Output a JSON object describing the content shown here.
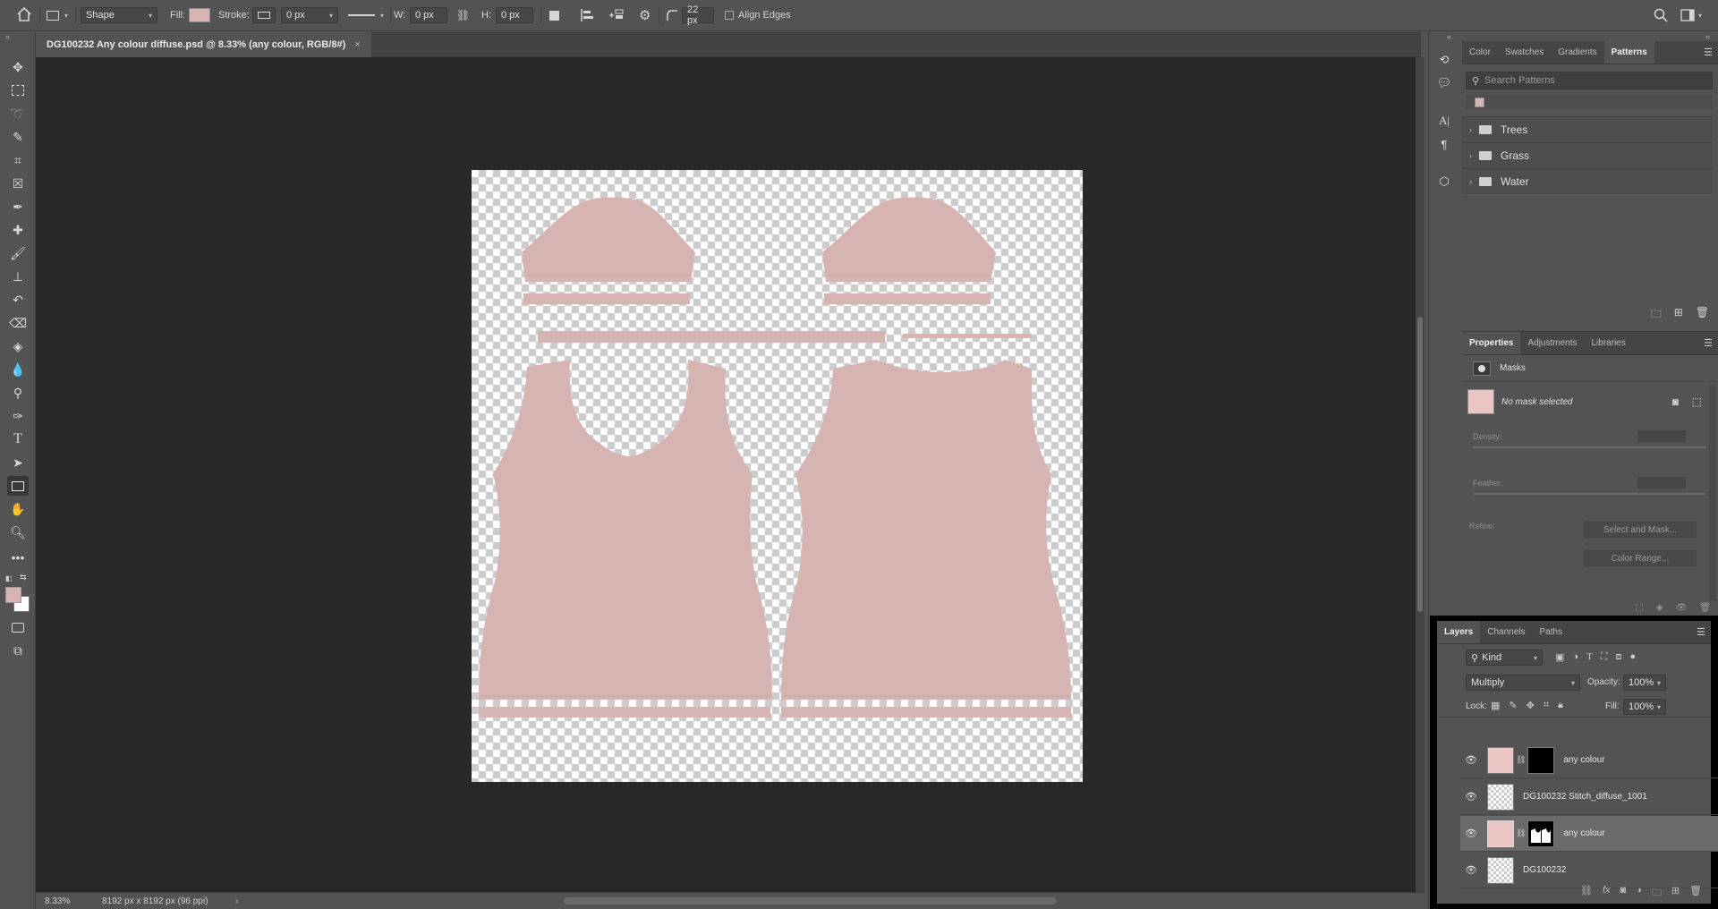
{
  "options_bar": {
    "mode": "Shape",
    "fill_label": "Fill:",
    "fill_color": "#d5b4b2",
    "stroke_label": "Stroke:",
    "stroke_width": "0 px",
    "w_label": "W:",
    "w_value": "0 px",
    "h_label": "H:",
    "h_value": "0 px",
    "radius": "22 px",
    "align_edges": "Align Edges"
  },
  "document": {
    "tab_title": "DG100232 Any colour diffuse.psd @ 8.33% (any colour, RGB/8#)",
    "close": "×",
    "fill_color": "#d5b4b2"
  },
  "status": {
    "zoom": "8.33%",
    "size": "8192 px x 8192 px (96 ppi)",
    "arrow": "›"
  },
  "patterns_panel": {
    "tabs": [
      "Color",
      "Swatches",
      "Gradients",
      "Patterns"
    ],
    "search_placeholder": "Search Patterns",
    "folders": [
      "Trees",
      "Grass",
      "Water"
    ]
  },
  "properties_panel": {
    "tabs": [
      "Properties",
      "Adjustments",
      "Libraries"
    ],
    "section": "Masks",
    "no_mask": "No mask selected",
    "density_label": "Density:",
    "feather_label": "Feather:",
    "refine_label": "Refine:",
    "select_and_mask": "Select and Mask...",
    "color_range": "Color Range..."
  },
  "layers_panel": {
    "tabs": [
      "Layers",
      "Channels",
      "Paths"
    ],
    "filter_kind": "Kind",
    "blend_mode": "Multiply",
    "opacity_label": "Opacity:",
    "opacity_value": "100%",
    "lock_label": "Lock:",
    "fill_label": "Fill:",
    "fill_value": "100%",
    "layers": [
      {
        "name": "any colour"
      },
      {
        "name": "DG100232 Stitch_diffuse_1001"
      },
      {
        "name": "any colour"
      },
      {
        "name": "DG100232"
      }
    ]
  },
  "colors": {
    "accent_pink": "#d5b4b2",
    "ui_bg": "#535353",
    "canvas_bg": "#282828"
  }
}
